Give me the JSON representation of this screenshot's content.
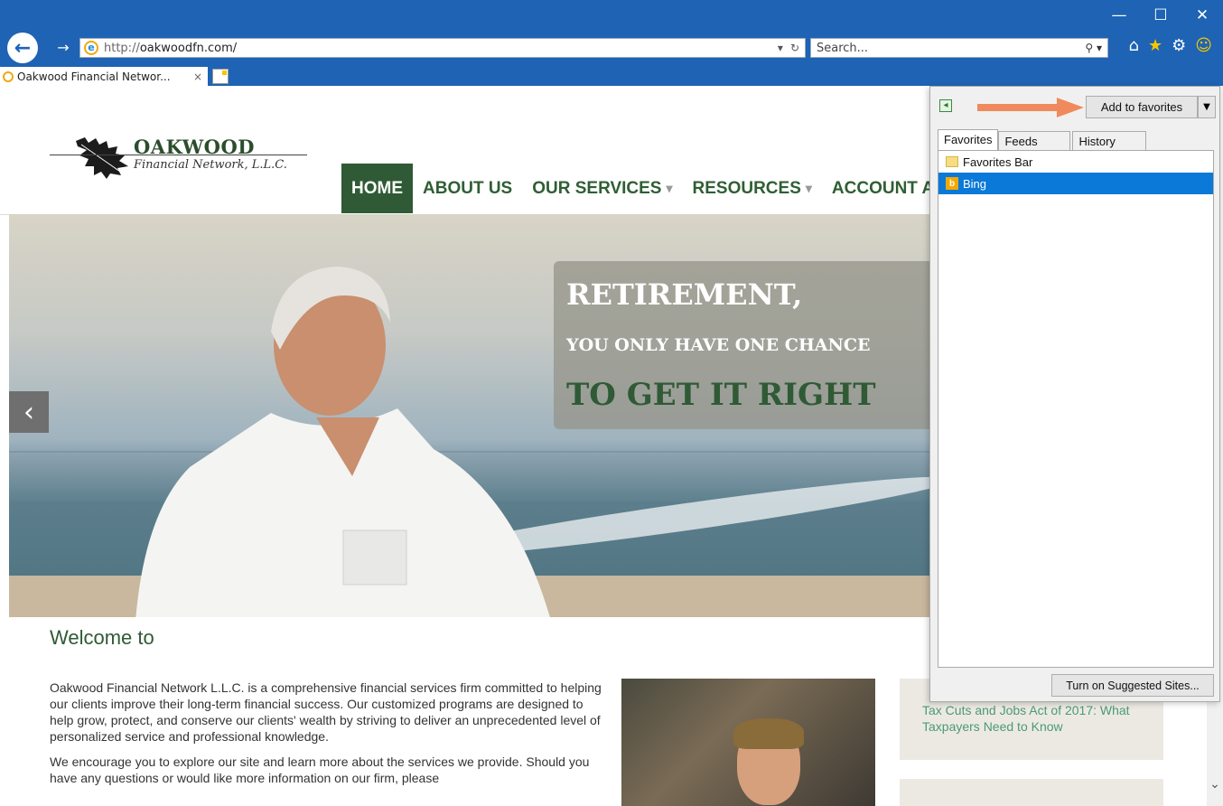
{
  "browser": {
    "url_prefix": "http://",
    "url_domain": "oakwoodfn.com/",
    "search_placeholder": "Search...",
    "tab_title": "Oakwood Financial Networ...",
    "tab_close": "×",
    "win_minimize": "—",
    "win_maximize": "☐",
    "win_close": "✕",
    "accent": "#1e63b4"
  },
  "site": {
    "logo_title": "OAKWOOD",
    "logo_subtitle": "Financial Network, L.L.C.",
    "nav": [
      "HOME",
      "ABOUT US",
      "OUR SERVICES",
      "RESOURCES",
      "ACCOUNT A"
    ],
    "hero": {
      "line1": "RETIREMENT,",
      "line2": "YOU ONLY HAVE ONE CHANCE",
      "line3": "TO GET IT RIGHT"
    },
    "welcome_heading": "Welcome to",
    "para1": "Oakwood Financial Network L.L.C. is a comprehensive financial services firm committed to helping our clients improve their long-term financial success. Our customized programs are designed to help grow, protect, and conserve our clients' wealth by striving to deliver an unprecedented level of personalized service and professional knowledge.",
    "para2": "We encourage you to explore our site and learn more about the services we provide. Should you have any questions or would like more information on our firm, please",
    "news_link": "Tax Cuts and Jobs Act of 2017: What Taxpayers Need to Know",
    "brand_color": "#2f5a35"
  },
  "favorites": {
    "add_button": "Add to favorites",
    "tabs": [
      "Favorites",
      "Feeds",
      "History"
    ],
    "items": [
      "Favorites Bar",
      "Bing"
    ],
    "suggested_button": "Turn on Suggested Sites...",
    "selection_color": "#0a79d8",
    "annotation_arrow_color": "#f08a5d"
  }
}
